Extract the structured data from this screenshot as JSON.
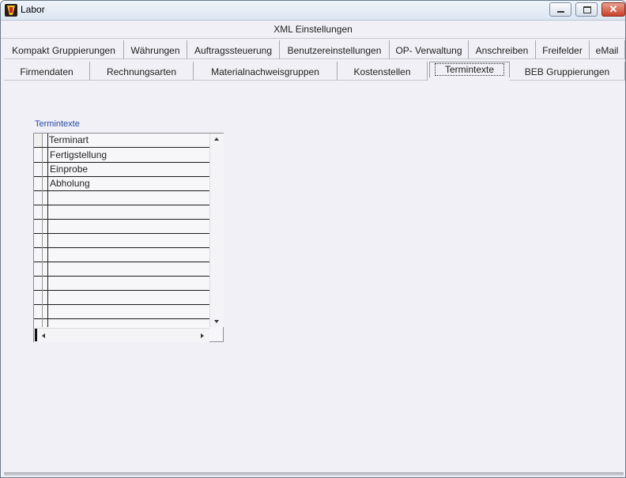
{
  "window": {
    "title": "Labor"
  },
  "header_tab": "XML Einstellungen",
  "tabs_row1": [
    "Kompakt Gruppierungen",
    "Währungen",
    "Auftragssteuerung",
    "Benutzereinstellungen",
    "OP- Verwaltung",
    "Anschreiben",
    "Freifelder",
    "eMail"
  ],
  "tabs_row2": [
    "Firmendaten",
    "Rechnungsarten",
    "Materialnachweisgruppen",
    "Kostenstellen",
    "Termintexte",
    "BEB Gruppierungen"
  ],
  "active_tab": "Termintexte",
  "section": {
    "label": "Termintexte",
    "grid": {
      "column": "Terminart",
      "rows": [
        "Fertigstellung",
        "Einprobe",
        "Abholung",
        "",
        "",
        "",
        "",
        "",
        "",
        "",
        "",
        "",
        ""
      ]
    }
  },
  "icons": {
    "app": "labor-app-icon",
    "minimize": "minimize-icon",
    "maximize": "maximize-icon",
    "close": "close-icon"
  }
}
